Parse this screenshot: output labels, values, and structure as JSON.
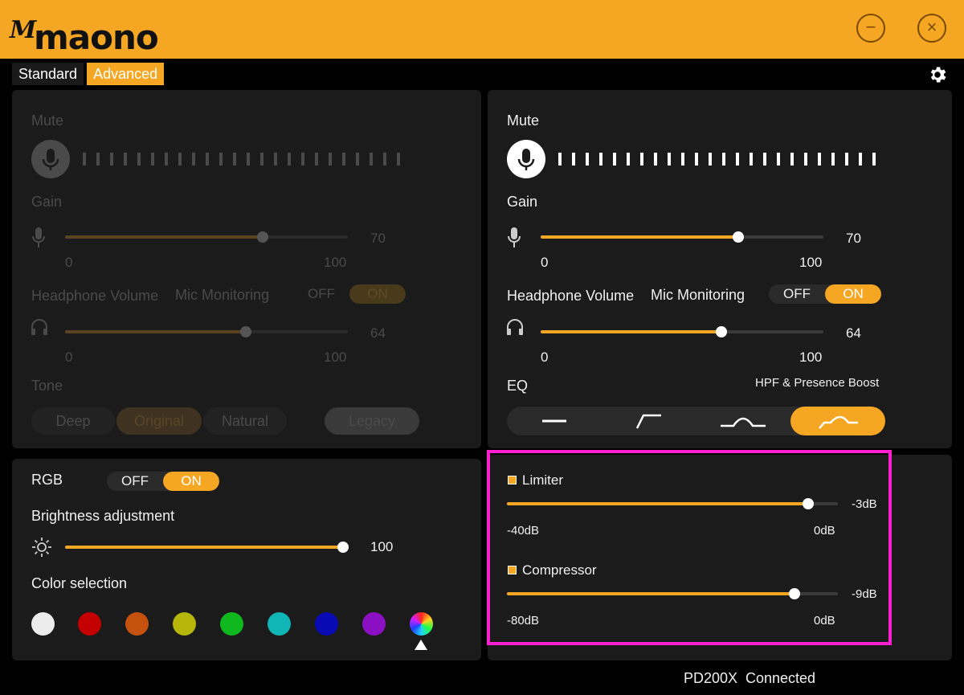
{
  "app": {
    "brand": "maono"
  },
  "tabs": [
    {
      "label": "Standard"
    },
    {
      "label": "Advanced"
    }
  ],
  "left_panel": {
    "mute_label": "Mute",
    "gain_label": "Gain",
    "gain_value": "70",
    "gain_min": "0",
    "gain_max": "100",
    "gain_level": 70,
    "headphone_label": "Headphone Volume",
    "mic_monitoring_label": "Mic Monitoring",
    "toggle_off": "OFF",
    "toggle_on": "ON",
    "hp_value": "64",
    "hp_min": "0",
    "hp_max": "100",
    "hp_level": 64,
    "tone_label": "Tone",
    "tone_options": [
      "Deep",
      "Original",
      "Natural"
    ],
    "legacy_label": "Legacy"
  },
  "right_panel": {
    "mute_label": "Mute",
    "gain_label": "Gain",
    "gain_value": "70",
    "gain_min": "0",
    "gain_max": "100",
    "gain_level": 70,
    "headphone_label": "Headphone Volume",
    "mic_monitoring_label": "Mic Monitoring",
    "toggle_off": "OFF",
    "toggle_on": "ON",
    "hp_value": "64",
    "hp_min": "0",
    "hp_max": "100",
    "hp_level": 64,
    "eq_label": "EQ",
    "eq_mode": "HPF & Presence Boost",
    "eq_options": [
      "flat-icon",
      "hpf-icon",
      "presence-icon",
      "hpf-presence-icon"
    ],
    "eq_selected": 3
  },
  "dynamics": {
    "limiter_label": "Limiter",
    "limiter_value": "-3dB",
    "limiter_min": "-40dB",
    "limiter_max": "0dB",
    "limiter_level": -3,
    "compressor_label": "Compressor",
    "compressor_value": "-9dB",
    "compressor_min": "-80dB",
    "compressor_max": "0dB",
    "compressor_level": -9
  },
  "rgb": {
    "rgb_label": "RGB",
    "toggle_off": "OFF",
    "toggle_on": "ON",
    "brightness_label": "Brightness adjustment",
    "brightness_value": "100",
    "brightness_level": 100,
    "color_label": "Color selection",
    "colors": [
      "#ececec",
      "#c40000",
      "#c4520e",
      "#b5b50a",
      "#10b820",
      "#10b5b5",
      "#0a0ab5",
      "#8b10c4",
      "rainbow"
    ]
  },
  "status": {
    "device": "PD200X",
    "state": "Connected"
  },
  "colors": {
    "accent": "#f5a623",
    "highlight": "#ff1fd1",
    "panel": "#1b1b1b"
  }
}
